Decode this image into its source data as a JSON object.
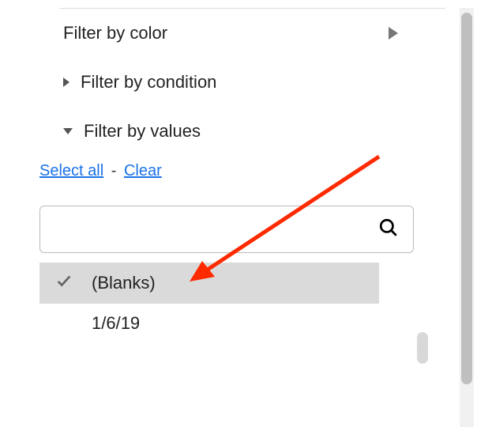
{
  "filters": {
    "color_label": "Filter by color",
    "condition_label": "Filter by condition",
    "values_label": "Filter by values"
  },
  "actions": {
    "select_all": "Select all",
    "clear": "Clear"
  },
  "search": {
    "placeholder": ""
  },
  "values": {
    "items": [
      {
        "label": "(Blanks)",
        "selected": true
      },
      {
        "label": "1/6/19",
        "selected": false
      }
    ]
  }
}
